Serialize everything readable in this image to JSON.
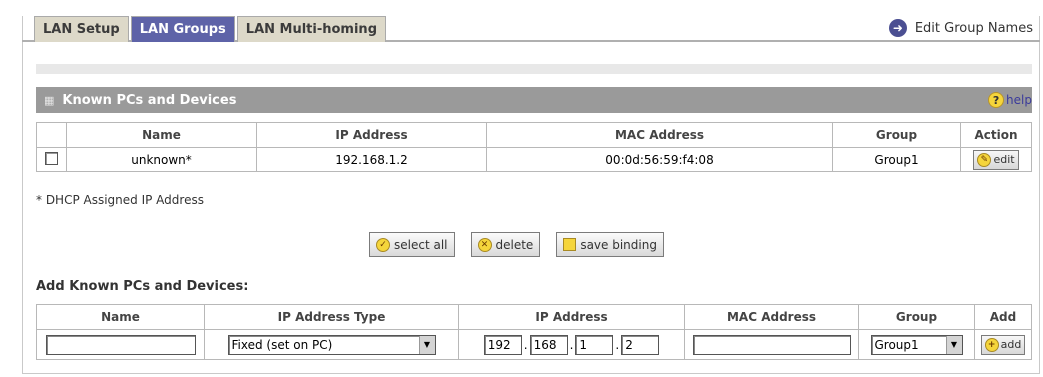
{
  "tabs": [
    {
      "label": "LAN Setup",
      "active": false
    },
    {
      "label": "LAN Groups",
      "active": true
    },
    {
      "label": "LAN Multi-homing",
      "active": false
    }
  ],
  "edit_group_names": "Edit Group Names",
  "known": {
    "title": "Known PCs and Devices",
    "help": "help",
    "headers": [
      "Name",
      "IP Address",
      "MAC Address",
      "Group",
      "Action"
    ],
    "rows": [
      {
        "name": "unknown*",
        "ip": "192.168.1.2",
        "mac": "00:0d:56:59:f4:08",
        "group": "Group1",
        "action": "edit"
      }
    ]
  },
  "note": "* DHCP Assigned IP Address",
  "buttons": {
    "select_all": "select all",
    "delete": "delete",
    "save_binding": "save binding"
  },
  "add": {
    "title": "Add Known PCs and Devices:",
    "headers": [
      "Name",
      "IP Address Type",
      "IP Address",
      "MAC Address",
      "Group",
      "Add"
    ],
    "name_value": "",
    "ip_type": "Fixed (set on PC)",
    "ip_octets": [
      "192",
      "168",
      "1",
      "2"
    ],
    "mac_value": "",
    "group": "Group1",
    "add_label": "add"
  },
  "colors": {
    "active_tab": "#5e63a8",
    "tab": "#ddd9c9",
    "section_header": "#9a9a9a",
    "accent_icon": "#f5d53b"
  }
}
